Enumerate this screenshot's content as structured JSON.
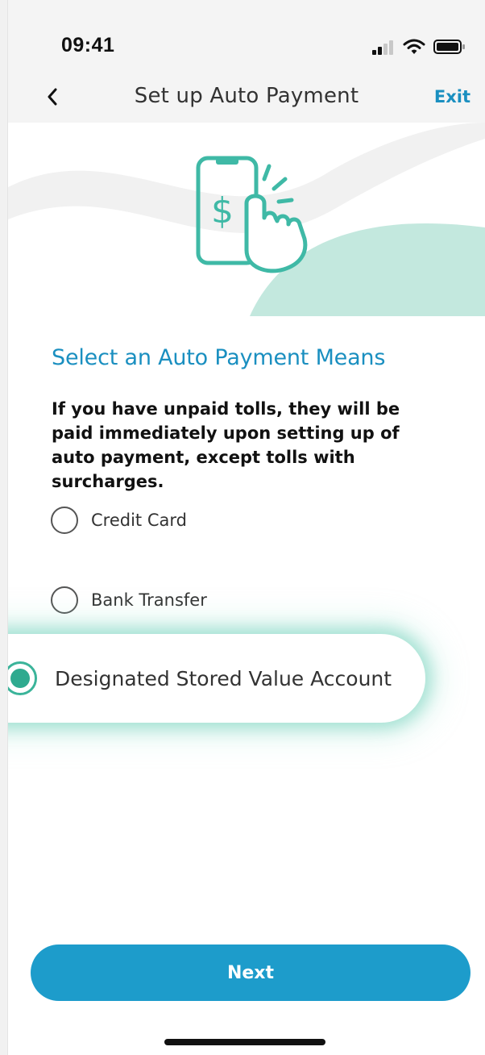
{
  "status_bar": {
    "time": "09:41",
    "icons": [
      "cellular-signal-icon",
      "wifi-icon",
      "battery-icon"
    ]
  },
  "nav": {
    "back_icon": "chevron-left-icon",
    "title": "Set up Auto Payment",
    "exit_label": "Exit"
  },
  "hero": {
    "icon": "phone-payment-tap-icon",
    "icon_color": "#3fb9a6",
    "wave_color": "#bfe6dc",
    "bg_wave_color": "#f2f2f2"
  },
  "content": {
    "heading": "Select an Auto Payment Means",
    "description": "If you have unpaid tolls, they will be paid immediately upon setting up of auto payment, except tolls with surcharges.",
    "options": [
      {
        "label": "Credit Card",
        "selected": false
      },
      {
        "label": "Bank Transfer",
        "selected": false
      },
      {
        "label": "Designated Stored Value Account",
        "selected": true
      }
    ]
  },
  "footer": {
    "next_label": "Next"
  },
  "colors": {
    "accent": "#1a8fc0",
    "button": "#1d9ccb",
    "selected_radio": "#2eaa8f",
    "highlight_glow": "#78d2be"
  }
}
